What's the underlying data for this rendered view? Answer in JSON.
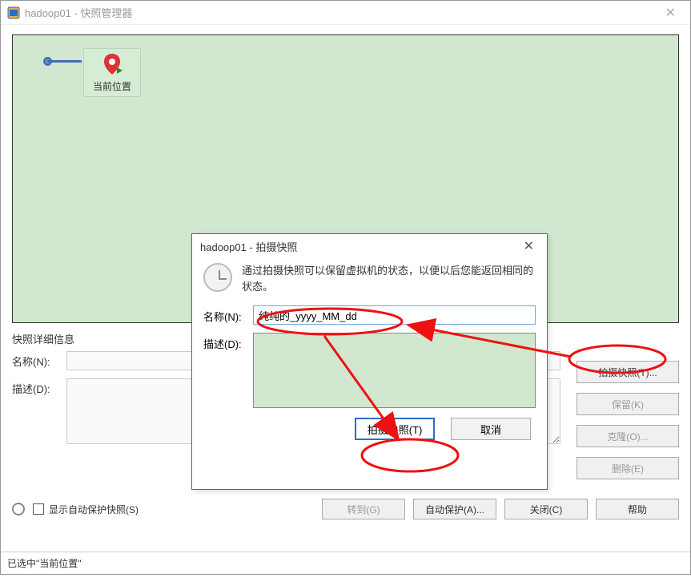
{
  "window": {
    "title": "hadoop01 - 快照管理器"
  },
  "canvas": {
    "current_label": "当前位置"
  },
  "details": {
    "section_title": "快照详细信息",
    "name_label": "名称(N):",
    "desc_label": "描述(D):",
    "name_value": "",
    "desc_value": ""
  },
  "panel": {
    "take": "拍摄快照(T)...",
    "keep": "保留(K)",
    "clone": "克隆(O)...",
    "delete": "删除(E)"
  },
  "bottom": {
    "show_auto": "显示自动保护快照(S)",
    "goto": "转到(G)",
    "autoprotect": "自动保护(A)...",
    "close": "关闭(C)",
    "help": "帮助"
  },
  "status": "已选中\"当前位置\"",
  "dialog": {
    "title": "hadoop01 - 拍摄快照",
    "info": "通过拍摄快照可以保留虚拟机的状态，以便以后您能返回相同的状态。",
    "name_label": "名称(N):",
    "name_value": "纯纯的_yyyy_MM_dd",
    "desc_label": "描述(D):",
    "desc_value": "",
    "ok": "拍摄快照(T)",
    "cancel": "取消"
  }
}
